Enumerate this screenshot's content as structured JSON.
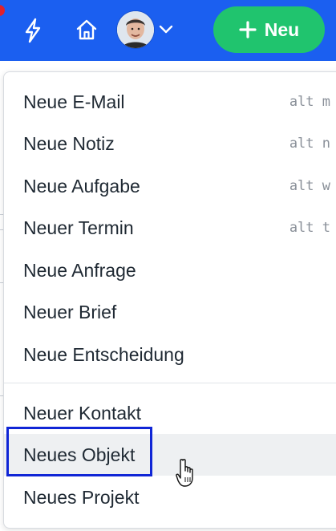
{
  "header": {
    "new_button_label": "Neu",
    "icons": [
      "bolt-icon",
      "home-icon",
      "user-avatar",
      "chevron-down-icon",
      "plus-icon"
    ],
    "colors": {
      "bar": "#1b5ff0",
      "new_button": "#20c46e",
      "notification_dot": "#e0212b"
    }
  },
  "menu": {
    "items": [
      {
        "label": "Neue E-Mail",
        "shortcut": "alt m"
      },
      {
        "label": "Neue Notiz",
        "shortcut": "alt n"
      },
      {
        "label": "Neue Aufgabe",
        "shortcut": "alt w"
      },
      {
        "label": "Neuer Termin",
        "shortcut": "alt t"
      },
      {
        "label": "Neue Anfrage"
      },
      {
        "label": "Neuer Brief"
      },
      {
        "label": "Neue Entscheidung"
      },
      {
        "label": "Neuer Kontakt"
      },
      {
        "label": "Neues Objekt"
      },
      {
        "label": "Neues Projekt"
      }
    ],
    "hovered_item": "Neues Objekt"
  }
}
